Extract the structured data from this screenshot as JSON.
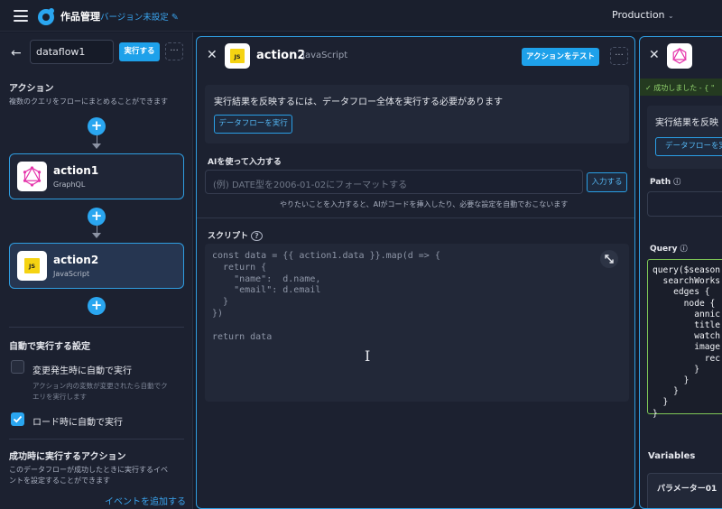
{
  "header": {
    "app_title": "作品管理",
    "version_label": "バージョン未設定",
    "environment": "Production"
  },
  "left": {
    "dataflow_name": "dataflow1",
    "run_label": "実行する",
    "actions_title": "アクション",
    "actions_desc": "複数のクエリをフローにまとめることができます",
    "actions": [
      {
        "name": "action1",
        "type": "GraphQL"
      },
      {
        "name": "action2",
        "type": "JavaScript"
      }
    ],
    "auto_title": "自動で実行する設定",
    "auto_on_change_label": "変更発生時に自動で実行",
    "auto_on_change_desc_1": "アクション内の変数が変更されたら自動でク",
    "auto_on_change_desc_2": "エリを実行します",
    "auto_on_load_label": "ロード時に自動で実行",
    "success_title": "成功時に実行するアクション",
    "success_desc_1": "このデータフローが成功したときに実行するイベ",
    "success_desc_2": "ントを設定することができます",
    "add_event_label": "イベントを追加する"
  },
  "middle": {
    "name": "action2",
    "type": "JavaScript",
    "js_badge": "JS",
    "test_label": "アクションをテスト",
    "info_text": "実行結果を反映するには、データフロー全体を実行する必要があります",
    "run_dataflow_label": "データフローを実行",
    "ai_label": "AIを使って入力する",
    "ai_placeholder": "(例) DATE型を2006-01-02にフォーマットする",
    "ai_input_label": "入力する",
    "ai_hint": "やりたいことを入力すると、AIがコードを挿入したり、必要な設定を自動でおこないます",
    "script_label": "スクリプト",
    "script_code": "const data = {{ action1.data }}.map(d => {\n  return {\n    \"name\":  d.name,\n    \"email\": d.email\n  }\n})\n\nreturn data"
  },
  "right": {
    "success_text": "成功しました - { \"",
    "info_text": "実行結果を反映",
    "run_label": "データフローを実",
    "path_label": "Path",
    "query_label": "Query",
    "query_code": "query($season\n  searchWorks\n    edges {\n      node {\n        annic\n        title\n        watch\n        image\n          rec\n        }\n      }\n    }\n  }\n}",
    "variables_label": "Variables",
    "param_label": "パラメーター01"
  },
  "colors": {
    "accent": "#1ea1ea",
    "background": "#161b29",
    "panel": "#1c2130",
    "success": "#92d46e"
  }
}
